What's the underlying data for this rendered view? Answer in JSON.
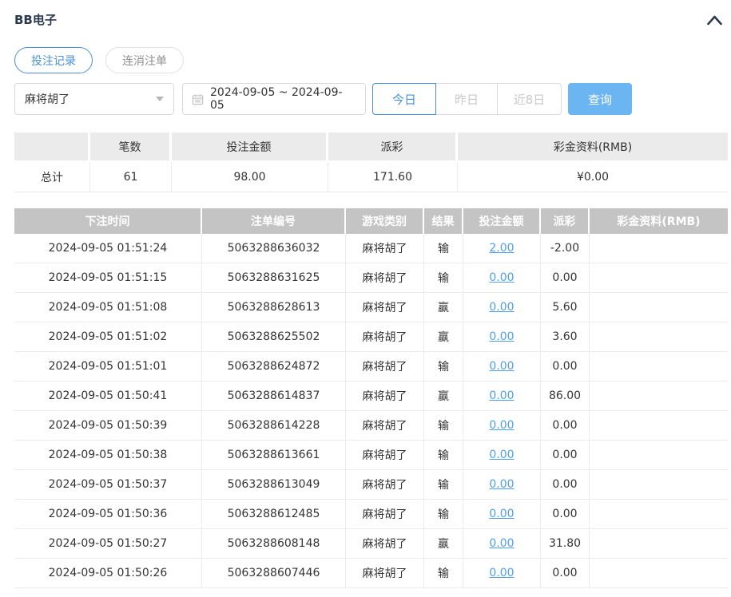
{
  "panel": {
    "title": "BB电子"
  },
  "tabs": [
    {
      "label": "投注记录",
      "active": true
    },
    {
      "label": "连消注单",
      "active": false
    }
  ],
  "filters": {
    "game_select": {
      "value": "麻将胡了"
    },
    "date_range": {
      "value": "2024-09-05 ~ 2024-09-05"
    },
    "quick_ranges": [
      {
        "label": "今日",
        "active": true
      },
      {
        "label": "昨日",
        "active": false
      },
      {
        "label": "近8日",
        "active": false
      }
    ],
    "search_button": "查询"
  },
  "summary": {
    "columns": [
      "",
      "笔数",
      "投注金额",
      "派彩",
      "彩金资料(RMB)"
    ],
    "total": {
      "label": "总计",
      "count": "61",
      "bet_amount": "98.00",
      "payout": "171.60",
      "bonus": "¥0.00"
    }
  },
  "table": {
    "columns": [
      "下注时间",
      "注单编号",
      "游戏类别",
      "结果",
      "投注金额",
      "派彩",
      "彩金资料(RMB)"
    ],
    "rows": [
      [
        "2024-09-05 01:51:24",
        "5063288636032",
        "麻将胡了",
        "输",
        "2.00",
        "-2.00",
        ""
      ],
      [
        "2024-09-05 01:51:15",
        "5063288631625",
        "麻将胡了",
        "输",
        "0.00",
        "0.00",
        ""
      ],
      [
        "2024-09-05 01:51:08",
        "5063288628613",
        "麻将胡了",
        "赢",
        "0.00",
        "5.60",
        ""
      ],
      [
        "2024-09-05 01:51:02",
        "5063288625502",
        "麻将胡了",
        "赢",
        "0.00",
        "3.60",
        ""
      ],
      [
        "2024-09-05 01:51:01",
        "5063288624872",
        "麻将胡了",
        "输",
        "0.00",
        "0.00",
        ""
      ],
      [
        "2024-09-05 01:50:41",
        "5063288614837",
        "麻将胡了",
        "赢",
        "0.00",
        "86.00",
        ""
      ],
      [
        "2024-09-05 01:50:39",
        "5063288614228",
        "麻将胡了",
        "输",
        "0.00",
        "0.00",
        ""
      ],
      [
        "2024-09-05 01:50:38",
        "5063288613661",
        "麻将胡了",
        "输",
        "0.00",
        "0.00",
        ""
      ],
      [
        "2024-09-05 01:50:37",
        "5063288613049",
        "麻将胡了",
        "输",
        "0.00",
        "0.00",
        ""
      ],
      [
        "2024-09-05 01:50:36",
        "5063288612485",
        "麻将胡了",
        "输",
        "0.00",
        "0.00",
        ""
      ],
      [
        "2024-09-05 01:50:27",
        "5063288608148",
        "麻将胡了",
        "赢",
        "0.00",
        "31.80",
        ""
      ],
      [
        "2024-09-05 01:50:26",
        "5063288607446",
        "麻将胡了",
        "输",
        "0.00",
        "0.00",
        ""
      ]
    ]
  },
  "colors": {
    "accent_blue": "#4a90d9",
    "search_button_bg": "#6cb5f3",
    "link_blue": "#4f9fe8",
    "negative_red": "#e25563",
    "table_header_bg": "#c4c4c4",
    "summary_header_bg": "#ebebeb"
  }
}
